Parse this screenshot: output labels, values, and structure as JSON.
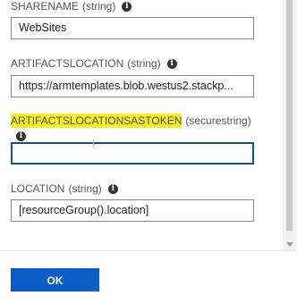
{
  "params": [
    {
      "name": "SHARENAME",
      "type": "(string)",
      "value": ""
    },
    {
      "name": "ARTIFACTSLOCATION",
      "type": "(string)",
      "value": "https://armtemplates.blob.westus2.stackp..."
    },
    {
      "name": "ARTIFACTSLOCATIONSASTOKEN",
      "type": "(securestring)",
      "value": ""
    },
    {
      "name": "LOCATION",
      "type": "(string)",
      "value": "[resourceGroup().location]"
    }
  ],
  "sharename_value": "WebSites",
  "highlight_color": "#f6ee2a",
  "ok_button": {
    "label": "OK",
    "color": "#0b5cc5"
  },
  "icons": {
    "info": "info-icon"
  }
}
